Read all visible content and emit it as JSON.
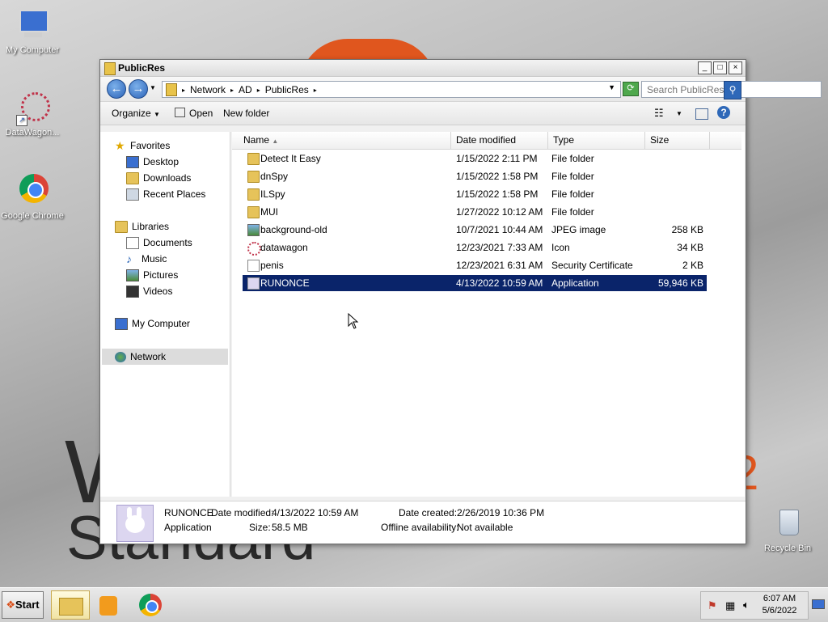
{
  "desktop": {
    "wallpaper_text": "W",
    "wallpaper_sub": "Standard",
    "wallpaper_num": "2",
    "icons": [
      {
        "label": "My Computer"
      },
      {
        "label": "DataWagon..."
      },
      {
        "label": "Google Chrome"
      },
      {
        "label": "Recycle Bin"
      }
    ]
  },
  "window": {
    "title": "PublicRes",
    "controls": {
      "minimize": "_",
      "maximize": "□",
      "close": "×"
    },
    "breadcrumb": [
      "Network",
      "AD",
      "PublicRes"
    ],
    "search_placeholder": "Search PublicRes",
    "toolbar": {
      "organize": "Organize",
      "open": "Open",
      "new_folder": "New folder"
    }
  },
  "navpane": {
    "favorites": {
      "label": "Favorites",
      "items": [
        "Desktop",
        "Downloads",
        "Recent Places"
      ]
    },
    "libraries": {
      "label": "Libraries",
      "items": [
        "Documents",
        "Music",
        "Pictures",
        "Videos"
      ]
    },
    "my_computer": "My Computer",
    "network": "Network"
  },
  "columns": {
    "name": "Name",
    "date": "Date modified",
    "type": "Type",
    "size": "Size"
  },
  "files": [
    {
      "name": "Detect It Easy",
      "date": "1/15/2022 2:11 PM",
      "type": "File folder",
      "size": ""
    },
    {
      "name": "dnSpy",
      "date": "1/15/2022 1:58 PM",
      "type": "File folder",
      "size": ""
    },
    {
      "name": "ILSpy",
      "date": "1/15/2022 1:58 PM",
      "type": "File folder",
      "size": ""
    },
    {
      "name": "MUI",
      "date": "1/27/2022 10:12 AM",
      "type": "File folder",
      "size": ""
    },
    {
      "name": "background-old",
      "date": "10/7/2021 10:44 AM",
      "type": "JPEG image",
      "size": "258 KB"
    },
    {
      "name": "datawagon",
      "date": "12/23/2021 7:33 AM",
      "type": "Icon",
      "size": "34 KB"
    },
    {
      "name": "penis",
      "date": "12/23/2021 6:31 AM",
      "type": "Security Certificate",
      "size": "2 KB"
    },
    {
      "name": "RUNONCE",
      "date": "4/13/2022 10:59 AM",
      "type": "Application",
      "size": "59,946 KB"
    }
  ],
  "details": {
    "name": "RUNONCE",
    "modified_label": "Date modified:",
    "modified": "4/13/2022 10:59 AM",
    "type": "Application",
    "size_label": "Size:",
    "size": "58.5 MB",
    "created_label": "Date created:",
    "created": "2/26/2019 10:36 PM",
    "offline_label": "Offline availability:",
    "offline": "Not available"
  },
  "taskbar": {
    "start": "Start",
    "time": "6:07 AM",
    "date": "5/6/2022"
  }
}
